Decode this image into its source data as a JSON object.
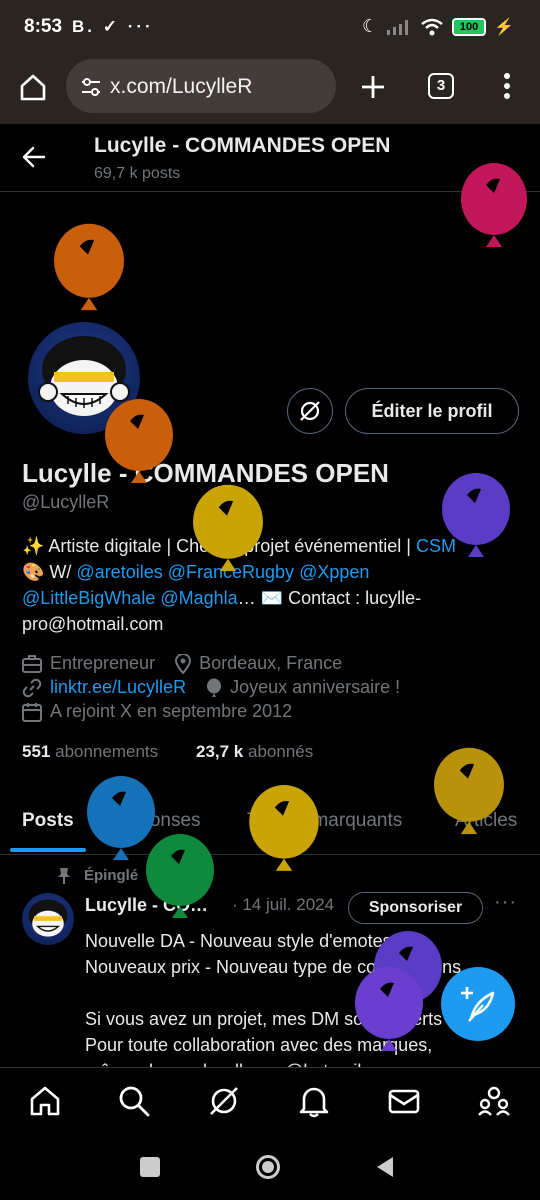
{
  "status_bar": {
    "time": "8:53",
    "notification_icons": "B. ✓ ···",
    "battery": "100"
  },
  "browser": {
    "url": "x.com/LucylleR",
    "tab_count": "3"
  },
  "header": {
    "name": "Lucylle - COMMANDES OPEN",
    "post_count": "69,7 k posts"
  },
  "profile": {
    "name": "Lucylle - COMMANDES OPEN",
    "handle": "@LucylleR",
    "edit_button": "Éditer le profil",
    "bio": {
      "line1_prefix": "✨ Artiste digitale | Chef de projet événementiel | ",
      "line1_link": "CSM",
      "line2_prefix": "🎨 W/ ",
      "mention1": "@aretoiles",
      "mention2": "@FranceRugby",
      "mention3": "@Xppen",
      "mention4": "@LittleBigWhale",
      "mention5": "@Maghla",
      "line3_suffix": "… ✉️ Contact : lucylle-",
      "line4": "pro@hotmail.com"
    },
    "job": "Entrepreneur",
    "location": "Bordeaux, France",
    "website": "linktr.ee/LucylleR",
    "birthday": "Joyeux anniversaire !",
    "joined": "A rejoint X en septembre 2012",
    "following_count": "551",
    "following_label": "abonnements",
    "followers_count": "23,7 k",
    "followers_label": "abonnés"
  },
  "tabs": [
    {
      "label": "Posts",
      "active": true
    },
    {
      "label": "Réponses",
      "active": false
    },
    {
      "label": "Tweets marquants",
      "active": false
    },
    {
      "label": "Articles",
      "active": false
    }
  ],
  "tweet": {
    "pinned_label": "Épinglé",
    "author": "Lucylle - CO…",
    "date": "· 14 juil. 2024",
    "sponsor_button": "Sponsoriser",
    "more": "···",
    "lines": [
      "Nouvelle DA - Nouveau style d'emotes -",
      "Nouveaux prix - Nouveau type de commissions",
      "",
      "Si vous avez un projet, mes DM sont ouverts",
      "Pour toute collaboration avec des marques,",
      "même chose : lucylle-pro@hotmail.com"
    ]
  },
  "colors": {
    "accent": "#1d9bf0",
    "background": "#000000",
    "muted_text": "#71767b",
    "balloon_colors": [
      "#c2185b",
      "#c95f0a",
      "#c9a406",
      "#5b3cc4",
      "#1571b8",
      "#0f8a3c",
      "#b8920a"
    ]
  },
  "icons": {
    "back": "arrow-left-icon",
    "grok": "grok-icon",
    "home": "home-icon",
    "search": "search-icon",
    "notifications": "bell-icon",
    "messages": "mail-icon",
    "communities": "people-icon",
    "compose": "feather-plus-icon"
  }
}
